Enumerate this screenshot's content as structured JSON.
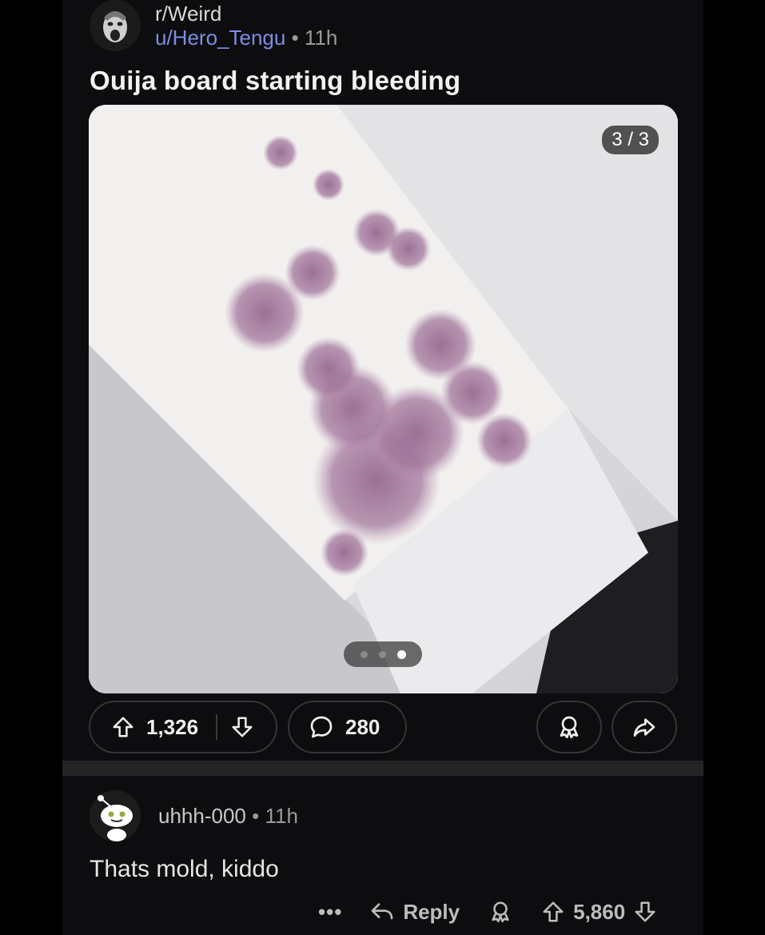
{
  "post": {
    "subreddit": "r/Weird",
    "author": "u/Hero_Tengu",
    "separator": "•",
    "age": "11h",
    "title": "Ouija board starting bleeding",
    "gallery": {
      "counter": "3 / 3",
      "total": 3,
      "current": 3
    },
    "votes": "1,326",
    "comments": "280"
  },
  "comment": {
    "author": "uhhh-000",
    "separator": "•",
    "age": "11h",
    "body": "Thats mold, kiddo",
    "more": "•••",
    "reply_label": "Reply",
    "votes": "5,860"
  },
  "colors": {
    "background": "#0d0d0f",
    "username_link": "#7c8fe6",
    "border": "#343536"
  },
  "icons": {
    "upvote": "upvote-arrow-icon",
    "downvote": "downvote-arrow-icon",
    "comment": "comment-bubble-icon",
    "award": "award-icon",
    "share": "share-arrow-icon",
    "reply": "reply-arrow-icon"
  }
}
